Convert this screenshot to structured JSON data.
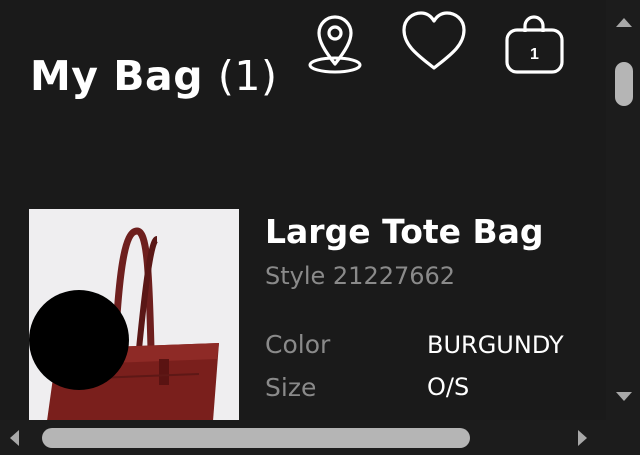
{
  "header": {
    "title": "My Bag",
    "count_text": "(1)",
    "icons": [
      "location-pin-icon",
      "heart-icon",
      "shopping-bag-icon"
    ],
    "bag_badge": "1"
  },
  "product": {
    "name": "Large Tote Bag",
    "style": "Style 21227662",
    "color_label": "Color",
    "color_value": "BURGUNDY",
    "size_label": "Size",
    "size_value": "O/S",
    "image": "burgundy-tote-bag-image"
  },
  "colors": {
    "background": "#1a1a1a",
    "text_primary": "#ffffff",
    "text_secondary": "#8a8a8a",
    "product_color": "#7a1f1c"
  },
  "scrollbars": {
    "vertical": true,
    "horizontal": true
  }
}
